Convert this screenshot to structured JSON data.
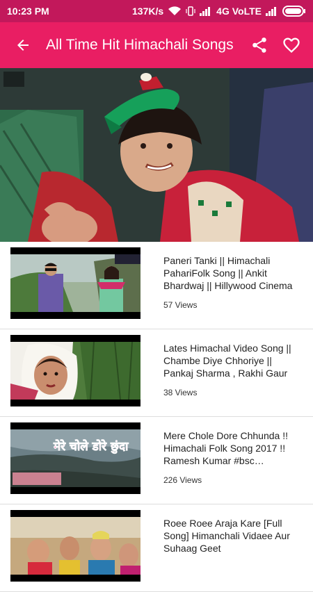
{
  "status_bar": {
    "time": "10:23 PM",
    "speed": "137K/s",
    "network": "4G VoLTE"
  },
  "app_bar": {
    "title": "All Time Hit Himachali Songs",
    "background": "#e91e63",
    "status_background": "#c2185b"
  },
  "videos": [
    {
      "title": "Paneri Tanki || Himachali PahariFolk Song || Ankit Bhardwaj || Hillywood Cinema",
      "views": "57 Views"
    },
    {
      "title": "Lates Himachal Video Song || Chambe Diye Chhoriye || Pankaj Sharma , Rakhi Gaur",
      "views": "38 Views"
    },
    {
      "title": "Mere Chole Dore Chhunda !! Himachali Folk Song 2017 !! Ramesh Kumar #bsc Entertainment",
      "views": "226 Views",
      "thumb_caption": "मेरे चोले डोरे छुंदा"
    },
    {
      "title": "Roee Roee Araja Kare [Full Song] Himanchali Vidaee  Aur Suhaag Geet",
      "views": ""
    }
  ]
}
